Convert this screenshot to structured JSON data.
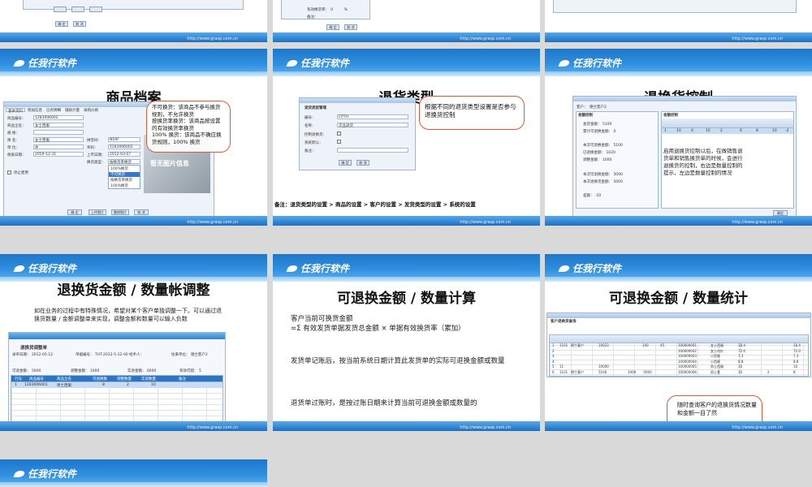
{
  "logo_text": "任我行软件",
  "footer_url": "http://www.grasp.com.cn",
  "top_row_buttons": {
    "slide1": [
      "确 定",
      "取 消"
    ],
    "slide2": [
      "确 定",
      "取 消"
    ]
  },
  "slides": {
    "product_archive": {
      "title": "商品档案",
      "callout": [
        "不可换货：该商品不参与换货规则，不允许换货",
        "按换货率换货：该商品按设置的有效换货率换货",
        "100% 换货：该商品不确应换货规则，100% 换货"
      ],
      "tabs": [
        "基本资料",
        "附加信息",
        "已有明细",
        "辅助计量",
        "采购价格",
        "物品等",
        "辅助备注"
      ],
      "fields": [
        {
          "label": "商品编号：",
          "value": "1283006002"
        },
        {
          "label": "商品全名：",
          "value": "女士西服"
        },
        {
          "label": "规  格：",
          "value": ""
        },
        {
          "label": "简  名：",
          "value": "女士西服"
        },
        {
          "label": "单  位：",
          "value": "件"
        },
        {
          "label": "保质日期：",
          "value": "2059-12-31"
        },
        {
          "label": "停用：",
          "value": ""
        }
      ],
      "right_fields": [
        {
          "label": "型号：",
          "value": ""
        },
        {
          "label": "拼音码：",
          "value": "NSXF"
        },
        {
          "label": "条码：",
          "value": "1283006002"
        },
        {
          "label": "上市日期：",
          "value": "2012-03-07"
        },
        {
          "label": "换货类型：",
          "value": "按换货率换货"
        }
      ],
      "dropdown_options": [
        "按换货率换货",
        "100%换货",
        "不可换货",
        "按换货率换货",
        "100%换货"
      ],
      "stop_checkbox": "停止使用",
      "image_placeholder": "暂无图片信息",
      "buttons": [
        "确 定",
        "上传图片",
        "删除图片",
        "取 消"
      ]
    },
    "return_type": {
      "title": "退货类型",
      "window_title": "退货类型管理",
      "fields": [
        {
          "label": "编号：",
          "value": "CPTH"
        },
        {
          "label": "名称：",
          "value": "次品退货"
        },
        {
          "label": "控制退换货：",
          "value": ""
        },
        {
          "label": "系统默认：",
          "value": ""
        },
        {
          "label": "备注：",
          "value": ""
        }
      ],
      "buttons": [
        "确 定",
        "取 消"
      ],
      "callout": "根据不同的退货类型设置是否参与退换货控制",
      "note": "备注：退货类型的设置 > 商品的设置 > 客户的设置 > 发货类型的设置 > 系统的设置"
    },
    "exchange_control": {
      "title": "退换货控制",
      "customer_label": "客户：",
      "customer_value": "德兰客户2",
      "panel_left_title": "金额控制",
      "amount_rows": [
        {
          "label": "发货金额：",
          "value": "5100"
        },
        {
          "label": "累计可退换金额：",
          "value": "0"
        },
        {
          "label": "本次可退换金额：",
          "value": "5100"
        },
        {
          "label": "已退换金额：",
          "value": "1020"
        },
        {
          "label": "调整金额：",
          "value": "1000"
        },
        {
          "label": "本次可退换金额：",
          "value": "5000"
        },
        {
          "label": "本次退换货金额：",
          "value": "5000"
        },
        {
          "label": "差额：",
          "value": "-20"
        }
      ],
      "panel_right_title": "数量控制",
      "qty_columns": [
        "行号",
        "可退换数量",
        "有效发货数量",
        "本次退换货数量",
        "累计可退换数量",
        "已退换数量",
        "调整数量",
        "数量"
      ],
      "qty_row": [
        "1",
        "10",
        "4",
        "10",
        "2",
        "6",
        "8",
        "10",
        "-2"
      ],
      "callout": "启用退换货控制以后，在做销售退货单和销售换货单的时候，会进行退换货的控制，右边是数量控制的提示，左边是数量控制的情况",
      "buttons": [
        "确定"
      ]
    },
    "adjust": {
      "title": "退换货金额 / 数量帐调整",
      "desc": "如在业务的过程中有特殊情况，希望对某个客户单独调整一下。可以通过退换货数量 / 金额调整单来实现，调整金额和数量可以输入负数",
      "menu": [
        "业务管理",
        "往来管理",
        "采购管理",
        "库存管理",
        "配送管理",
        "仓库管理",
        "日经管理",
        "单据中心",
        "辅助业务",
        "系统管理"
      ],
      "doc_title": "退换货调整单",
      "doc_fields": [
        {
          "label": "录单日期：",
          "value": "2012-05-12"
        },
        {
          "label": "单据编号：",
          "value": "THT-2012-5-12-00"
        },
        {
          "label": "经手人：",
          "value": ""
        },
        {
          "label": "往来单位：",
          "value": "德兰客户2"
        },
        {
          "label": "可退金额：",
          "value": "5000"
        },
        {
          "label": "调整金额：",
          "value": "1000"
        },
        {
          "label": "实退金额：",
          "value": "6000"
        },
        {
          "label": "有效可配：",
          "value": "5"
        }
      ],
      "columns": [
        "行号",
        "商品编号",
        "商品全名",
        "可退换数",
        "调整数量",
        "实退数量",
        "备注"
      ],
      "rows": [
        [
          "1",
          "1283006001",
          "男士西服",
          "8",
          "2",
          "10",
          ""
        ]
      ]
    },
    "calc": {
      "title": "可退换金额 / 数量计算",
      "paragraphs": [
        "客户当前可换货金额\n=Σ 有效发货单据发货总金额 × 单据有效换货率（累加）",
        "发货单记账后，按当前系统日期计算此发货单的实际可退换金额或数量",
        "退货单过账时，是按过账日期来计算当前可退换金额或数量的"
      ]
    },
    "stats": {
      "title": "可退换金额 / 数量统计",
      "window_title": "客户退换货查询",
      "callout": "随时查询客户的退换货情况数量和金额一目了然",
      "rows": [
        [
          "1",
          "1101",
          "德兰客户",
          "10023",
          "",
          "",
          "100",
          "45",
          "100000001",
          "女士西服",
          "18.4",
          "",
          "18.4"
        ],
        [
          "2",
          "",
          "",
          "",
          "",
          "",
          "",
          "",
          "100000002",
          "女士衬衫",
          "72.0",
          "",
          "72.0"
        ],
        [
          "3",
          "",
          "",
          "",
          "",
          "",
          "",
          "",
          "100000003",
          "小西装",
          "7.3",
          "",
          "7.3"
        ],
        [
          "4",
          "",
          "",
          "",
          "",
          "",
          "",
          "",
          "100000004",
          "小西裤",
          "8.8",
          "",
          "8.8"
        ],
        [
          "5",
          "11",
          "",
          "10000",
          "",
          "",
          "",
          "",
          "100000005",
          "男士西服",
          "10",
          "",
          "10"
        ],
        [
          "6",
          "1101",
          "德兰客户",
          "5100",
          "",
          "1000",
          "-5000",
          "",
          "100000006",
          "男士套",
          "10",
          "2",
          "8"
        ]
      ]
    }
  }
}
